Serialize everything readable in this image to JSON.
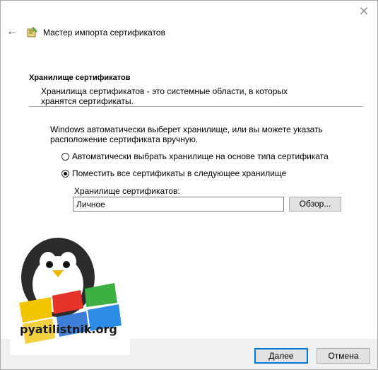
{
  "window": {
    "title": "Мастер импорта сертификатов"
  },
  "section": {
    "heading": "Хранилище сертификатов",
    "description": "Хранилища сертификатов - это системные области, в которых хранятся сертификаты."
  },
  "intro": "Windows автоматически выберет хранилище, или вы можете указать расположение сертификата вручную.",
  "options": [
    {
      "label": "Автоматически выбрать хранилище на основе типа сертификата",
      "selected": false
    },
    {
      "label": "Поместить все сертификаты в следующее хранилище",
      "selected": true
    }
  ],
  "store": {
    "label": "Хранилище сертификатов:",
    "value": "Личное",
    "browse_label": "Обзор..."
  },
  "footer": {
    "next_label": "Далее",
    "cancel_label": "Отмена"
  },
  "watermark": {
    "text": "pyatilistnik.org"
  },
  "icons": {
    "close": "close-icon",
    "back": "back-arrow-icon",
    "wizard": "certificate-icon"
  },
  "colors": {
    "accent": "#0078d7",
    "footer_bg": "#f0f0f0"
  }
}
